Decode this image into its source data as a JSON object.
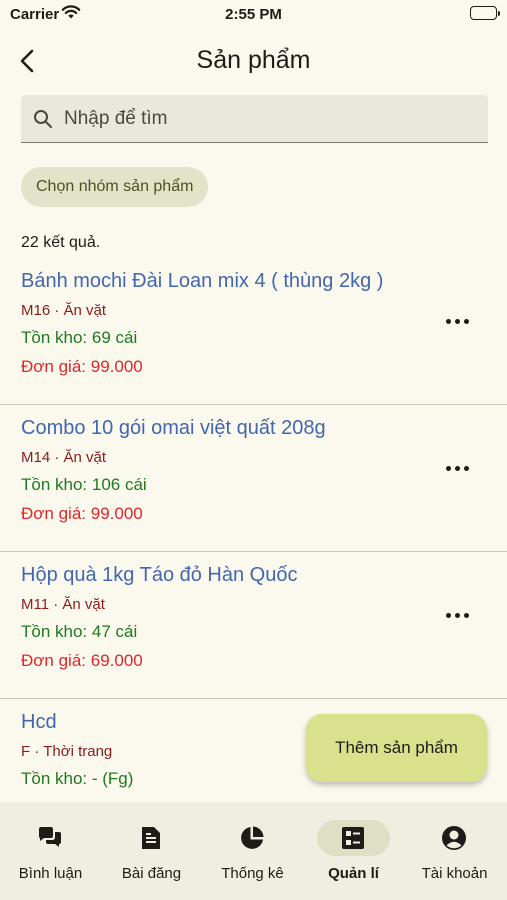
{
  "status_bar": {
    "carrier": "Carrier",
    "time": "2:55 PM"
  },
  "app_bar": {
    "title": "Sản phẩm"
  },
  "search": {
    "placeholder": "Nhập để tìm",
    "value": ""
  },
  "filter_chip": {
    "label": "Chọn nhóm sản phẩm"
  },
  "result_count": "22 kết quả.",
  "products": [
    {
      "name": "Bánh mochi Đài Loan mix 4 ( thùng 2kg )",
      "sub": "M16 · Ăn vặt",
      "stock": "Tồn kho: 69 cái",
      "price": "Đơn giá: 99.000"
    },
    {
      "name": "Combo 10 gói omai việt quất 208g",
      "sub": "M14 · Ăn vặt",
      "stock": "Tồn kho: 106 cái",
      "price": "Đơn giá: 99.000"
    },
    {
      "name": "Hộp quà 1kg Táo đỏ Hàn Quốc",
      "sub": "M11 · Ăn vặt",
      "stock": "Tồn kho: 47 cái",
      "price": "Đơn giá: 69.000"
    },
    {
      "name": "Hcd",
      "sub": "F · Thời trang",
      "stock": "Tồn kho: - (Fg)",
      "price": ""
    }
  ],
  "fab": {
    "label": "Thêm sản phẩm"
  },
  "bottom_nav": [
    {
      "label": "Bình luận",
      "icon": "comments-icon"
    },
    {
      "label": "Bài đăng",
      "icon": "document-icon"
    },
    {
      "label": "Thống kê",
      "icon": "pie-chart-icon"
    },
    {
      "label": "Quản lí",
      "icon": "list-manage-icon",
      "active": true
    },
    {
      "label": "Tài khoản",
      "icon": "account-icon"
    }
  ],
  "colors": {
    "background": "#fbf9ee",
    "product_name": "#4366b0",
    "stock": "#1f7a1f",
    "price": "#e0262a",
    "sub": "#8a1c1c",
    "fab": "#d9e18c"
  }
}
